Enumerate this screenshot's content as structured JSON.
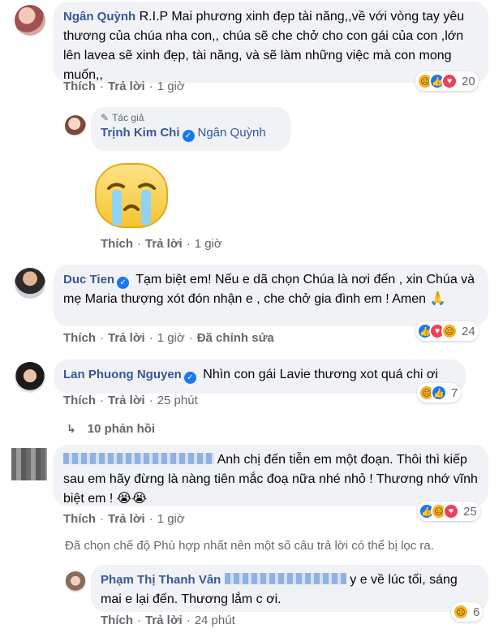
{
  "colors": {
    "accent": "#385898",
    "bubble": "#f0f2f5",
    "meta": "#65676b",
    "like": "#1877f2",
    "love": "#f33e58",
    "sad": "#f7b125"
  },
  "comments": [
    {
      "name": "Ngân Quỳnh",
      "text": "R.I.P Mai phương xinh đẹp tài năng,,về với vòng tay yêu thương của chúa nha con,, chúa sẽ che chở cho con gái của con ,lớn lên lavea sẽ xinh đẹp, tài năng, và sẽ làm những việc mà con mong muốn,,",
      "like": "Thích",
      "reply": "Trả lời",
      "time": "1 giờ",
      "reaction_count": "20"
    },
    {
      "author_badge": "Tác giả",
      "name": "Trịnh Kim Chi",
      "tag": "Ngân Quỳnh",
      "sticker": "crying-face",
      "like": "Thích",
      "reply": "Trả lời",
      "time": "1 giờ"
    },
    {
      "name": "Duc Tien",
      "text": "Tạm biệt em! Nếu e dã chọn Chúa là nơi đến , xin Chúa và mẹ Maria thượng xót đón nhận e , che chở gia đình em ! Amen 🙏",
      "like": "Thích",
      "reply": "Trả lời",
      "time": "1 giờ",
      "edited": "Đã chỉnh sửa",
      "reaction_count": "24"
    },
    {
      "name": "Lan Phuong Nguyen",
      "text": "Nhìn con gái Lavie thương xot quá chi ơi",
      "like": "Thích",
      "reply": "Trả lời",
      "time": "25 phút",
      "reaction_count": "7"
    },
    {
      "replies_label": "10 phản hồi"
    },
    {
      "text_after_blur": "Anh chị đến tiễn em một đoạn. Thôi thì kiếp sau em hãy đừng là nàng tiên mắc đoạ nữa nhé nhỏ ! Thương nhớ vĩnh biệt em ! 😭😭",
      "like": "Thích",
      "reply": "Trả lời",
      "time": "1 giờ",
      "reaction_count": "25"
    },
    {
      "filter_notice": "Đã chọn chế độ Phù hợp nhất nên một số câu trả lời có thể bị lọc ra."
    },
    {
      "name": "Phạm Thị Thanh Vân",
      "text_after_blur": "y e về lúc tối, sáng mai e lại đến. Thương lắm c ơi.",
      "like": "Thích",
      "reply": "Trả lời",
      "time": "24 phút",
      "reaction_count": "6"
    }
  ]
}
